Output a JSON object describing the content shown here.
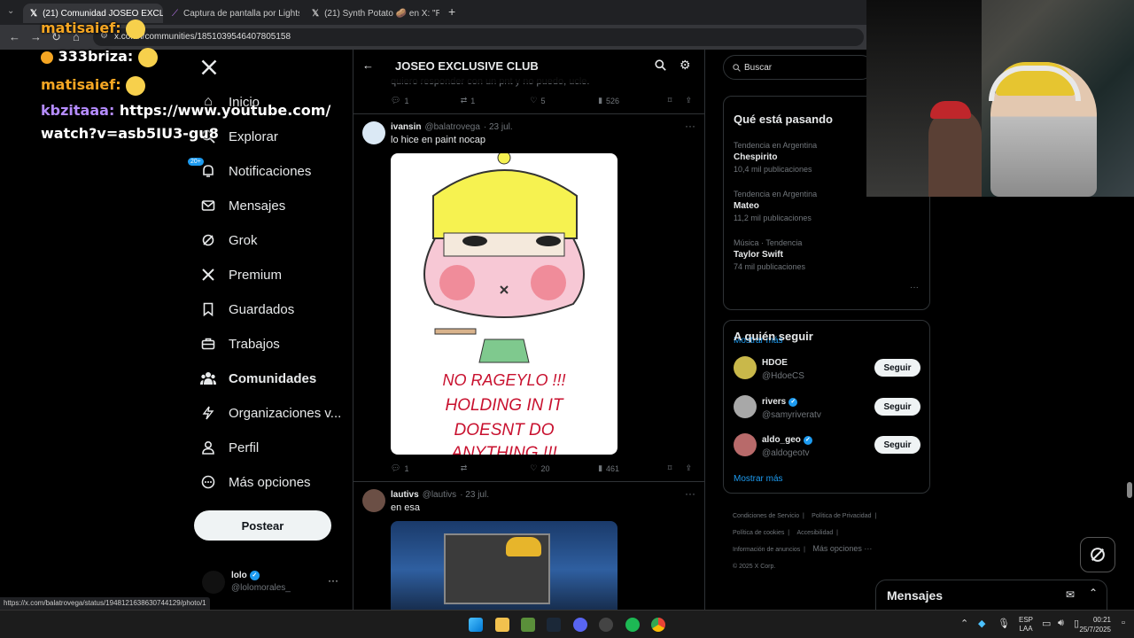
{
  "browser": {
    "tabs": [
      {
        "title": "(21) Comunidad JOSEO EXCLUS",
        "active": true
      },
      {
        "title": "Captura de pantalla por Lightsh",
        "active": false
      },
      {
        "title": "(21) Synth Potato 🥔 en X: \"Re",
        "active": false
      }
    ],
    "url": "x.com/i/communities/1851039546407805158",
    "status_url": "https://x.com/balatrovega/status/1948121638630744129/photo/1"
  },
  "chat": [
    {
      "user": "matisaief",
      "text": ""
    },
    {
      "user": "333briza",
      "text": ""
    },
    {
      "user": "matisaief",
      "text": ""
    },
    {
      "user": "kbzitaaa",
      "text": "https://www.youtube.com/watch?v=asb5IU3-gu8"
    }
  ],
  "nav": {
    "items": [
      {
        "label": "Inicio",
        "icon": "home-icon"
      },
      {
        "label": "Explorar",
        "icon": "search-icon"
      },
      {
        "label": "Notificaciones",
        "icon": "bell-icon",
        "badge": "20+"
      },
      {
        "label": "Mensajes",
        "icon": "mail-icon"
      },
      {
        "label": "Grok",
        "icon": "grok-icon"
      },
      {
        "label": "Premium",
        "icon": "x-logo-icon"
      },
      {
        "label": "Guardados",
        "icon": "bookmark-icon"
      },
      {
        "label": "Trabajos",
        "icon": "briefcase-icon"
      },
      {
        "label": "Comunidades",
        "icon": "communities-icon"
      },
      {
        "label": "Organizaciones v...",
        "icon": "lightning-icon"
      },
      {
        "label": "Perfil",
        "icon": "person-icon"
      },
      {
        "label": "Más opciones",
        "icon": "more-circle-icon"
      }
    ],
    "post_label": "Postear",
    "account": {
      "name": "lolo",
      "handle": "@lolomorales_"
    }
  },
  "community": {
    "title": "JOSEO EXCLUSIVE CLUB"
  },
  "tweets": [
    {
      "partial_text": "quiero responder con un pnt y no puedo, ucle.",
      "replies": "1",
      "reposts": "1",
      "likes": "5",
      "views": "526"
    },
    {
      "name": "ivansin",
      "handle": "@balatrovega",
      "date": "· 23 jul.",
      "text": "lo hice en paint nocap",
      "image_text_1": "NO RAGEYLO !!!",
      "image_text_2": "HOLDING IN IT",
      "image_text_3": "DOESNT DO",
      "image_text_4": "ANYTHING !!!",
      "replies": "1",
      "reposts": "",
      "likes": "20",
      "views": "461"
    },
    {
      "name": "lautivs",
      "handle": "@lautivs",
      "date": "· 23 jul.",
      "text": "en esa"
    }
  ],
  "search": {
    "placeholder": "Buscar"
  },
  "trends": {
    "title": "Qué está pasando",
    "items": [
      {
        "category": "Tendencia en Argentina",
        "name": "Chespirito",
        "count": "10,4 mil publicaciones"
      },
      {
        "category": "Tendencia en Argentina",
        "name": "Mateo",
        "count": "11,2 mil publicaciones"
      },
      {
        "category": "Música · Tendencia",
        "name": "Taylor Swift",
        "count": "74 mil publicaciones"
      }
    ],
    "show_more": "Mostrar más"
  },
  "who_to_follow": {
    "title": "A quién seguir",
    "users": [
      {
        "name": "HDOE",
        "handle": "@HdoeCS",
        "button": "Seguir"
      },
      {
        "name": "rivers",
        "handle": "@samyriveratv",
        "button": "Seguir"
      },
      {
        "name": "aldo_geo",
        "handle": "@aldogeotv",
        "button": "Seguir"
      }
    ],
    "show_more": "Mostrar más"
  },
  "footer": {
    "links": [
      "Condiciones de Servicio",
      "Política de Privacidad",
      "Política de cookies",
      "Accesibilidad",
      "Información de anuncios",
      "Más opciones ···"
    ],
    "copyright": "© 2025 X Corp."
  },
  "messages_dock": {
    "title": "Mensajes"
  },
  "taskbar": {
    "lang_1": "ESP",
    "lang_2": "LAA",
    "time": "00:21",
    "date": "25/7/2025"
  },
  "colors": {
    "accent": "#1d9bf0",
    "background": "#000000",
    "chat_orange": "#f5a623",
    "chat_purple": "#b58cff"
  }
}
